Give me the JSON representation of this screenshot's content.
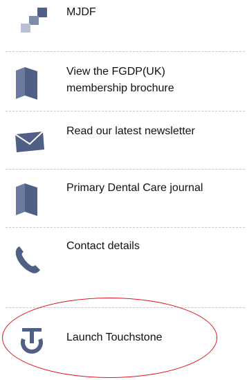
{
  "colors": {
    "icon": "#4f5f86",
    "text": "#111111",
    "divider": "#c8c8c8",
    "highlight_oval": "#e2141e"
  },
  "items": [
    {
      "label": "MJDF",
      "icon": "stacked-squares-icon"
    },
    {
      "label": "View the FGDP(UK) membership brochure",
      "icon": "brochure-icon"
    },
    {
      "label": "Read our latest newsletter",
      "icon": "envelope-icon"
    },
    {
      "label": "Primary Dental Care journal",
      "icon": "journal-icon"
    },
    {
      "label": "Contact details",
      "icon": "phone-icon"
    },
    {
      "label": "Launch Touchstone",
      "icon": "touchstone-icon"
    }
  ]
}
